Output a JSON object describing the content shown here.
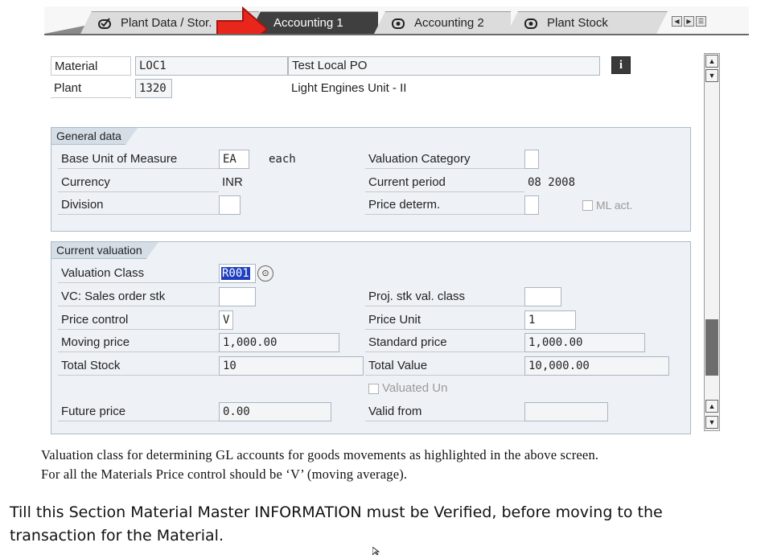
{
  "tabs": [
    {
      "label": "Plant Data / Stor."
    },
    {
      "label": "Accounting 1"
    },
    {
      "label": "Accounting 2"
    },
    {
      "label": "Plant Stock"
    }
  ],
  "header": {
    "material_label": "Material",
    "material_value": "LOC1",
    "material_desc": "Test Local PO",
    "plant_label": "Plant",
    "plant_value": "1320",
    "plant_desc": "Light Engines Unit - II"
  },
  "general_data": {
    "title": "General data",
    "base_uom_label": "Base Unit of Measure",
    "base_uom_value": "EA",
    "base_uom_text": "each",
    "currency_label": "Currency",
    "currency_value": "INR",
    "division_label": "Division",
    "division_value": "",
    "valuation_category_label": "Valuation Category",
    "valuation_category_value": "",
    "current_period_label": "Current period",
    "current_period_value": "08 2008",
    "price_determ_label": "Price determ.",
    "price_determ_value": "",
    "ml_act_label": "ML act."
  },
  "current_valuation": {
    "title": "Current valuation",
    "valuation_class_label": "Valuation Class",
    "valuation_class_value": "R001",
    "vc_sales_label": "VC: Sales order stk",
    "vc_sales_value": "",
    "proj_stk_label": "Proj. stk val. class",
    "proj_stk_value": "",
    "price_control_label": "Price control",
    "price_control_value": "V",
    "price_unit_label": "Price Unit",
    "price_unit_value": "1",
    "moving_price_label": "Moving price",
    "moving_price_value": "1,000.00",
    "standard_price_label": "Standard price",
    "standard_price_value": "1,000.00",
    "total_stock_label": "Total Stock",
    "total_stock_value": "10",
    "total_value_label": "Total Value",
    "total_value_value": "10,000.00",
    "valuated_un_label": "Valuated Un",
    "future_price_label": "Future price",
    "future_price_value": "0.00",
    "valid_from_label": "Valid from",
    "valid_from_value": ""
  },
  "caption": {
    "line1": "Valuation class for determining GL accounts for goods movements as highlighted in the above screen.",
    "line2": "For all the Materials Price control should be ‘V’ (moving average)."
  },
  "note": {
    "line1": "Till this Section Material Master INFORMATION must be Verified, before moving to the",
    "line2": "transaction for the Material."
  },
  "colors": {
    "arrow": "#e8261c",
    "active_tab": "#3f3f3f",
    "highlight": "#1f3fbf"
  }
}
